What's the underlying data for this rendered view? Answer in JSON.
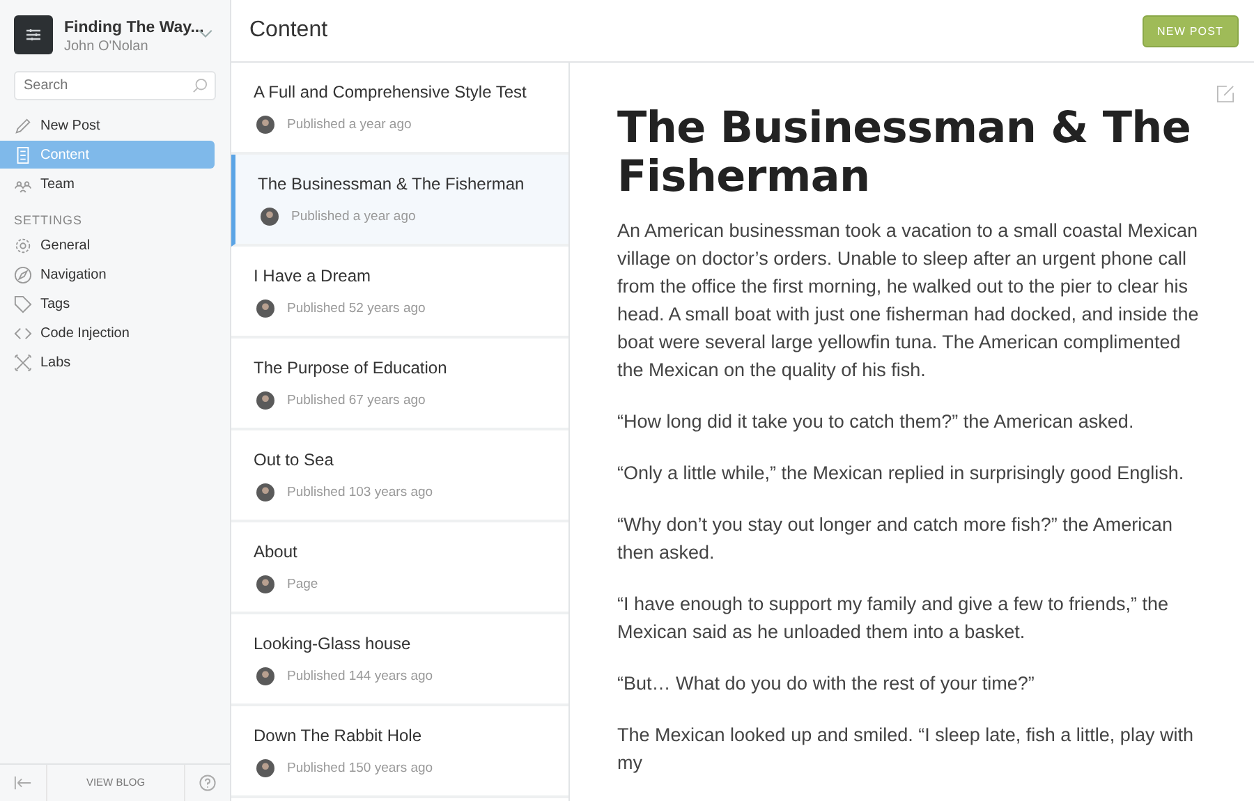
{
  "blog": {
    "title": "Finding The Way...",
    "user": "John O'Nolan"
  },
  "search": {
    "placeholder": "Search"
  },
  "nav": [
    {
      "label": "New Post",
      "selected": false
    },
    {
      "label": "Content",
      "selected": true
    },
    {
      "label": "Team",
      "selected": false
    }
  ],
  "settings": {
    "heading": "SETTINGS",
    "items": [
      {
        "label": "General",
        "selected": false
      },
      {
        "label": "Navigation",
        "selected": false
      },
      {
        "label": "Tags",
        "selected": false
      },
      {
        "label": "Code Injection",
        "selected": false
      },
      {
        "label": "Labs",
        "selected": false
      }
    ]
  },
  "footer": {
    "view_blog": "VIEW BLOG"
  },
  "header": {
    "title": "Content",
    "new_post": "NEW POST"
  },
  "posts": [
    {
      "title": "A Full and Comprehensive Style Test",
      "meta": "Published a year ago",
      "selected": false
    },
    {
      "title": "The Businessman & The Fisherman",
      "meta": "Published a year ago",
      "selected": true
    },
    {
      "title": "I Have a Dream",
      "meta": "Published 52 years ago",
      "selected": false
    },
    {
      "title": "The Purpose of Education",
      "meta": "Published 67 years ago",
      "selected": false
    },
    {
      "title": "Out to Sea",
      "meta": "Published 103 years ago",
      "selected": false
    },
    {
      "title": "About",
      "meta": "Page",
      "selected": false
    },
    {
      "title": "Looking-Glass house",
      "meta": "Published 144 years ago",
      "selected": false
    },
    {
      "title": "Down The Rabbit Hole",
      "meta": "Published 150 years ago",
      "selected": false
    }
  ],
  "article": {
    "title": "The Businessman & The Fisherman",
    "paragraphs": [
      "An American businessman took a vacation to a small coastal Mexican village on doctor’s orders. Unable to sleep after an urgent phone call from the office the first morning, he walked out to the pier to clear his head. A small boat with just one fisherman had docked, and inside the boat were several large yellowfin tuna. The American complimented the Mexican on the quality of his fish.",
      "“How long did it take you to catch them?” the American asked.",
      "“Only a little while,” the Mexican replied in surprisingly good English.",
      "“Why don’t you stay out longer and catch more fish?” the American then asked.",
      "“I have enough to support my family and give a few to friends,” the Mexican said as he unloaded them into a basket.",
      "“But… What do you do with the rest of your time?”",
      "The Mexican looked up and smiled. “I sleep late, fish a little, play with my"
    ]
  }
}
